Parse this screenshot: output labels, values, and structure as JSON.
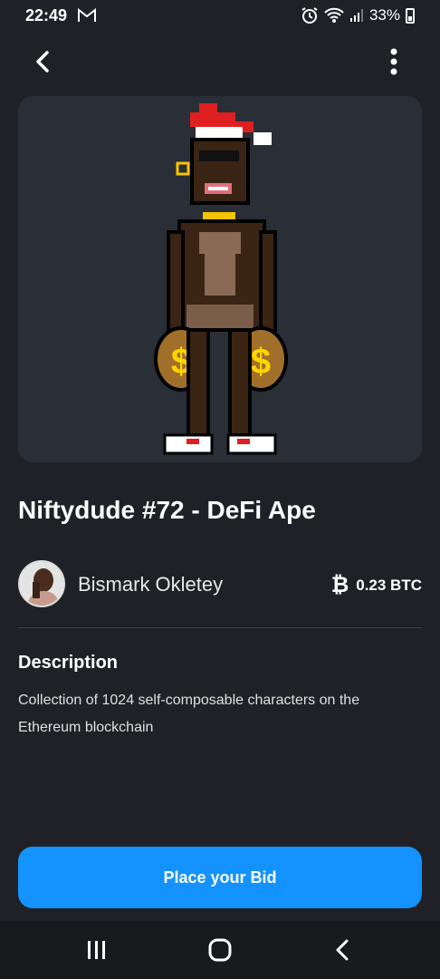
{
  "status_bar": {
    "time": "22:49",
    "battery": "33%",
    "icons": [
      "gmail-icon",
      "alarm-icon",
      "wifi-icon",
      "signal-icon",
      "battery-icon"
    ]
  },
  "top_bar": {
    "back_icon": "chevron-left-icon",
    "more_icon": "more-vertical-icon"
  },
  "nft": {
    "title": "Niftydude #72 - DeFi Ape",
    "image": "pixel-art-ape-with-santa-hat-and-money-bags"
  },
  "owner": {
    "name": "Bismark Okletey",
    "avatar": "user-avatar"
  },
  "price": {
    "currency_symbol": "₿",
    "value": "0.23 BTC"
  },
  "description": {
    "heading": "Description",
    "text": "Collection of 1024 self-composable characters on the Ethereum blockchain"
  },
  "actions": {
    "bid_label": "Place your Bid"
  },
  "nav_bar": {
    "items": [
      "recent-apps-icon",
      "home-icon",
      "back-icon"
    ]
  },
  "colors": {
    "background": "#1f2126",
    "card": "#2a2e36",
    "accent": "#1493ff"
  }
}
